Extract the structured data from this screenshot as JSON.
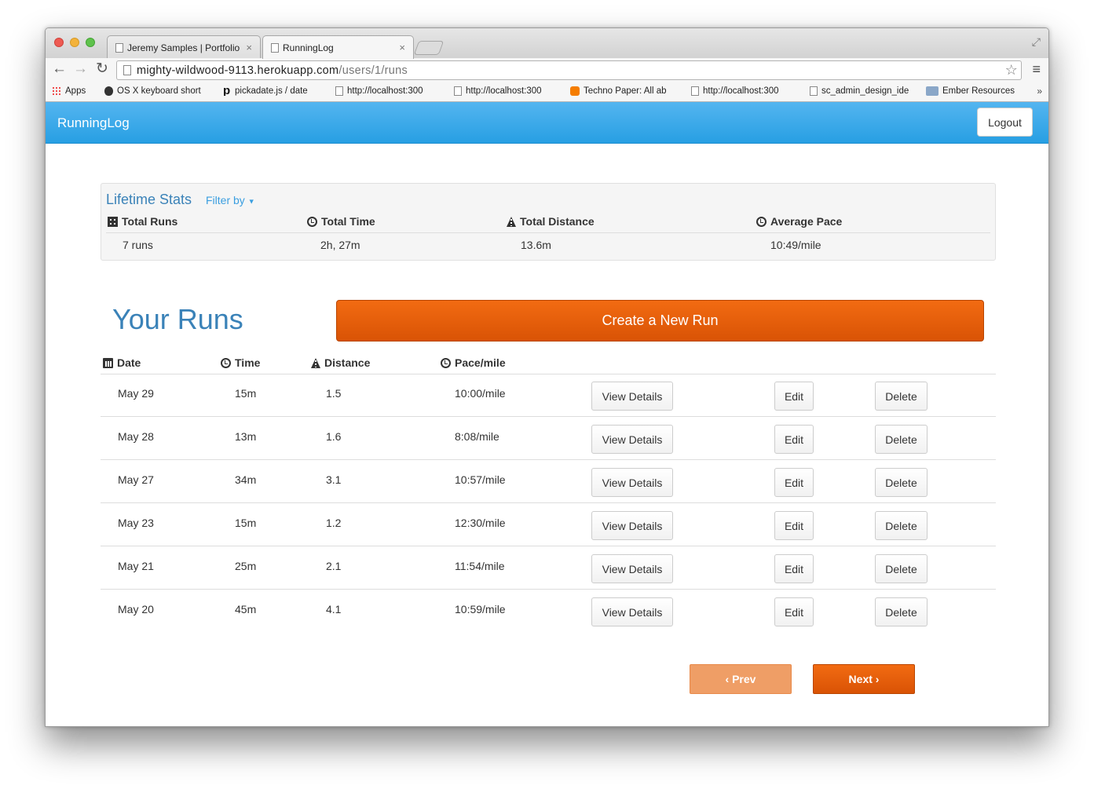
{
  "browser": {
    "tabs": [
      {
        "title": "Jeremy Samples | Portfolio"
      },
      {
        "title": "RunningLog"
      }
    ],
    "url_host": "mighty-wildwood-9113.herokuapp.com",
    "url_path": "/users/1/runs",
    "bookmarks": [
      {
        "label": "Apps",
        "icon": "apps-grid-icon"
      },
      {
        "label": "OS X keyboard short",
        "icon": "apple-icon"
      },
      {
        "label": "pickadate.js / date",
        "icon": "pickadate-icon"
      },
      {
        "label": "http://localhost:300",
        "icon": "page-icon"
      },
      {
        "label": "http://localhost:300",
        "icon": "page-icon"
      },
      {
        "label": "Techno Paper: All ab",
        "icon": "blogger-icon"
      },
      {
        "label": "http://localhost:300",
        "icon": "page-icon"
      },
      {
        "label": "sc_admin_design_ide",
        "icon": "page-icon"
      },
      {
        "label": "Ember Resources",
        "icon": "folder-icon"
      }
    ],
    "bookmarks_more": "»"
  },
  "app": {
    "brand": "RunningLog",
    "logout_label": "Logout",
    "accent_color": "#279fe3",
    "action_color": "#e65f0a"
  },
  "stats": {
    "title": "Lifetime Stats",
    "filter_label": "Filter by",
    "headers": {
      "runs": "Total Runs",
      "time": "Total Time",
      "distance": "Total Distance",
      "pace": "Average Pace"
    },
    "values": {
      "runs": "7 runs",
      "time": "2h, 27m",
      "distance": "13.6m",
      "pace": "10:49/mile"
    }
  },
  "runs": {
    "title": "Your Runs",
    "create_label": "Create a New Run",
    "headers": {
      "date": "Date",
      "time": "Time",
      "distance": "Distance",
      "pace": "Pace/mile"
    },
    "rows": [
      {
        "date": "May 29",
        "time": "15m",
        "distance": "1.5",
        "pace": "10:00/mile"
      },
      {
        "date": "May 28",
        "time": "13m",
        "distance": "1.6",
        "pace": "8:08/mile"
      },
      {
        "date": "May 27",
        "time": "34m",
        "distance": "3.1",
        "pace": "10:57/mile"
      },
      {
        "date": "May 23",
        "time": "15m",
        "distance": "1.2",
        "pace": "12:30/mile"
      },
      {
        "date": "May 21",
        "time": "25m",
        "distance": "2.1",
        "pace": "11:54/mile"
      },
      {
        "date": "May 20",
        "time": "45m",
        "distance": "4.1",
        "pace": "10:59/mile"
      }
    ],
    "view_label": "View Details",
    "edit_label": "Edit",
    "delete_label": "Delete"
  },
  "pagination": {
    "prev_label": "‹ Prev",
    "next_label": "Next ›"
  }
}
